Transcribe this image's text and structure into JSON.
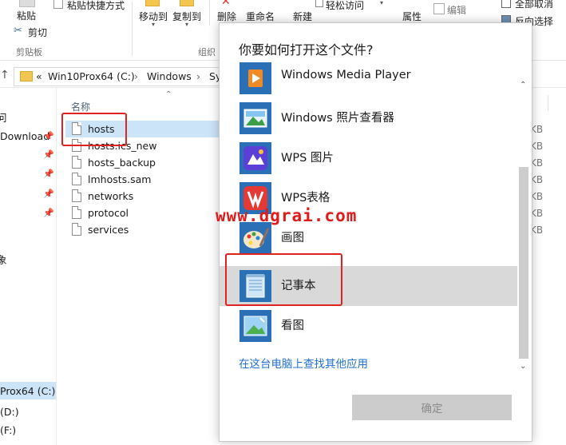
{
  "ribbon": {
    "paste_label": "粘贴",
    "paste_shortcut_label": "粘贴快捷方式",
    "cut_label": "剪切",
    "clipboard_group": "剪贴板",
    "move_to_label": "移动到",
    "copy_to_label": "复制到",
    "delete_label": "删除",
    "rename_label": "重命名",
    "organize_group": "组织",
    "new_label": "新建",
    "easy_access_label": "轻松访问",
    "properties_label": "属性",
    "edit_label": "编辑",
    "select_all_label": "全部取消",
    "invert_selection_label": "反向选择"
  },
  "address": {
    "overflow": "«",
    "crumbs": [
      "Win10Prox64 (C:)",
      "Windows",
      "Sy"
    ]
  },
  "nav": {
    "items": [
      "问",
      "Download",
      "象",
      "Prox64 (C:)",
      "(D:)",
      "(F:)"
    ]
  },
  "file_list": {
    "column_name": "名称",
    "files": [
      "hosts",
      "hosts.ics_new",
      "hosts_backup",
      "lmhosts.sam",
      "networks",
      "protocol",
      "services"
    ],
    "sizes": [
      "KB",
      "KB",
      "KB",
      "KB",
      "KB",
      "KB",
      "KB"
    ]
  },
  "dialog": {
    "title": "你要如何打开这个文件?",
    "apps": [
      {
        "name": "Windows Media Player",
        "icon": "media-player-icon"
      },
      {
        "name": "Windows 照片查看器",
        "icon": "photo-viewer-icon"
      },
      {
        "name": "WPS 图片",
        "icon": "wps-picture-icon"
      },
      {
        "name": "WPS表格",
        "icon": "wps-spreadsheet-icon"
      },
      {
        "name": "画图",
        "icon": "paint-icon"
      },
      {
        "name": "记事本",
        "icon": "notepad-icon"
      },
      {
        "name": "看图",
        "icon": "image-viewer-icon"
      }
    ],
    "selected_app": "记事本",
    "more_apps_link": "在这台电脑上查找其他应用",
    "ok_label": "确定"
  },
  "watermark": "www.dgrai.com",
  "colors": {
    "accent_link": "#1f6fd1",
    "highlight_box": "#e0231e",
    "selection": "#cce4f7"
  }
}
